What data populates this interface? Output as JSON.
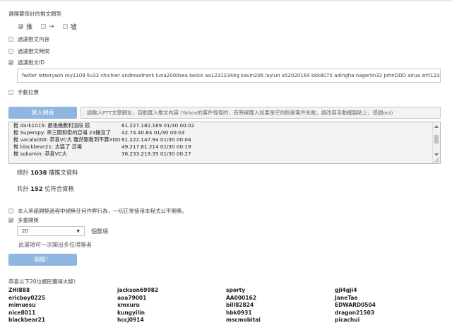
{
  "push_type": {
    "heading": "選擇要採計的推文類型",
    "options": [
      {
        "label": "推",
        "checked": true
      },
      {
        "label": "→",
        "checked": false
      },
      {
        "label": "噓",
        "checked": false
      }
    ]
  },
  "filters": {
    "content_label": "過濾推文內容",
    "time_label": "過濾推文時間",
    "id_label": "過濾推文ID",
    "id_value": "fwiller lotterywin roy1109 liu33 chichier andreasfrank luna2000sea koiick aa12312344g kavin206 laylun a52020164  kkk8075 adingha nagerlin32 JohnDDD airua srtt123 guai",
    "manual_label": "手動拉票"
  },
  "import": {
    "button_label": "匯入網頁",
    "url_placeholder": "請輸入PTT文章網址，自動匯入推文內容 (Yahoo的客件怪怪的，有時候匯入如果是空的則是客件失敗，請改用手動複製貼上，感謝orz)"
  },
  "push_lines": [
    {
      "text": "推 dark1015: 最後幾數利沒段 鉸",
      "meta": "61.227.182.169 01/30 00:02"
    },
    {
      "text": "推 Superspy: 串三闖和街的目場 23擔沒了",
      "meta": "42.74.40.64 01/30 00:03"
    },
    {
      "text": "推 vacala000: 恭喜VC大 雖然剛看到不算XDD",
      "meta": "61.222.147.94 01/30 00:04"
    },
    {
      "text": "推 blackbear21: 太猛了 這場",
      "meta": "49.217.61.214 01/30 00:19"
    },
    {
      "text": "推 sokamin: 恭喜VC大",
      "meta": "36.233.219.35 01/30 00:27"
    }
  ],
  "stats": {
    "total_prefix": "總計",
    "total_count": "1038",
    "total_suffix": "樓推文資料",
    "qualified_prefix": "共計",
    "qualified_count": "152",
    "qualified_suffix": "位符合資格"
  },
  "draw": {
    "fair_label": "本人承諾開獎過程中絕無任何作弊行為，一切正常使用本程式公平開獎。",
    "multi_label": "多重開獎",
    "count_value": "20",
    "count_suffix": "個獎項",
    "hint": "此選項可一次開出多位得獎者",
    "button_label": "開獎！"
  },
  "winners": {
    "heading": "恭喜以下20位鄉民獲得大獎！",
    "names": [
      "ZHI888",
      "jackson69982",
      "sporty",
      "gji4gji4",
      "ericboy0225",
      "aoa79001",
      "AA000162",
      "JaneTae",
      "mimuesu",
      "xmxuru",
      "bill82824",
      "EDWARD0504",
      "nice8011",
      "kungyilin",
      "hbk0931",
      "dragon21503",
      "blackbear21",
      "hccj0914",
      "mscmobitai",
      "picachui"
    ]
  }
}
